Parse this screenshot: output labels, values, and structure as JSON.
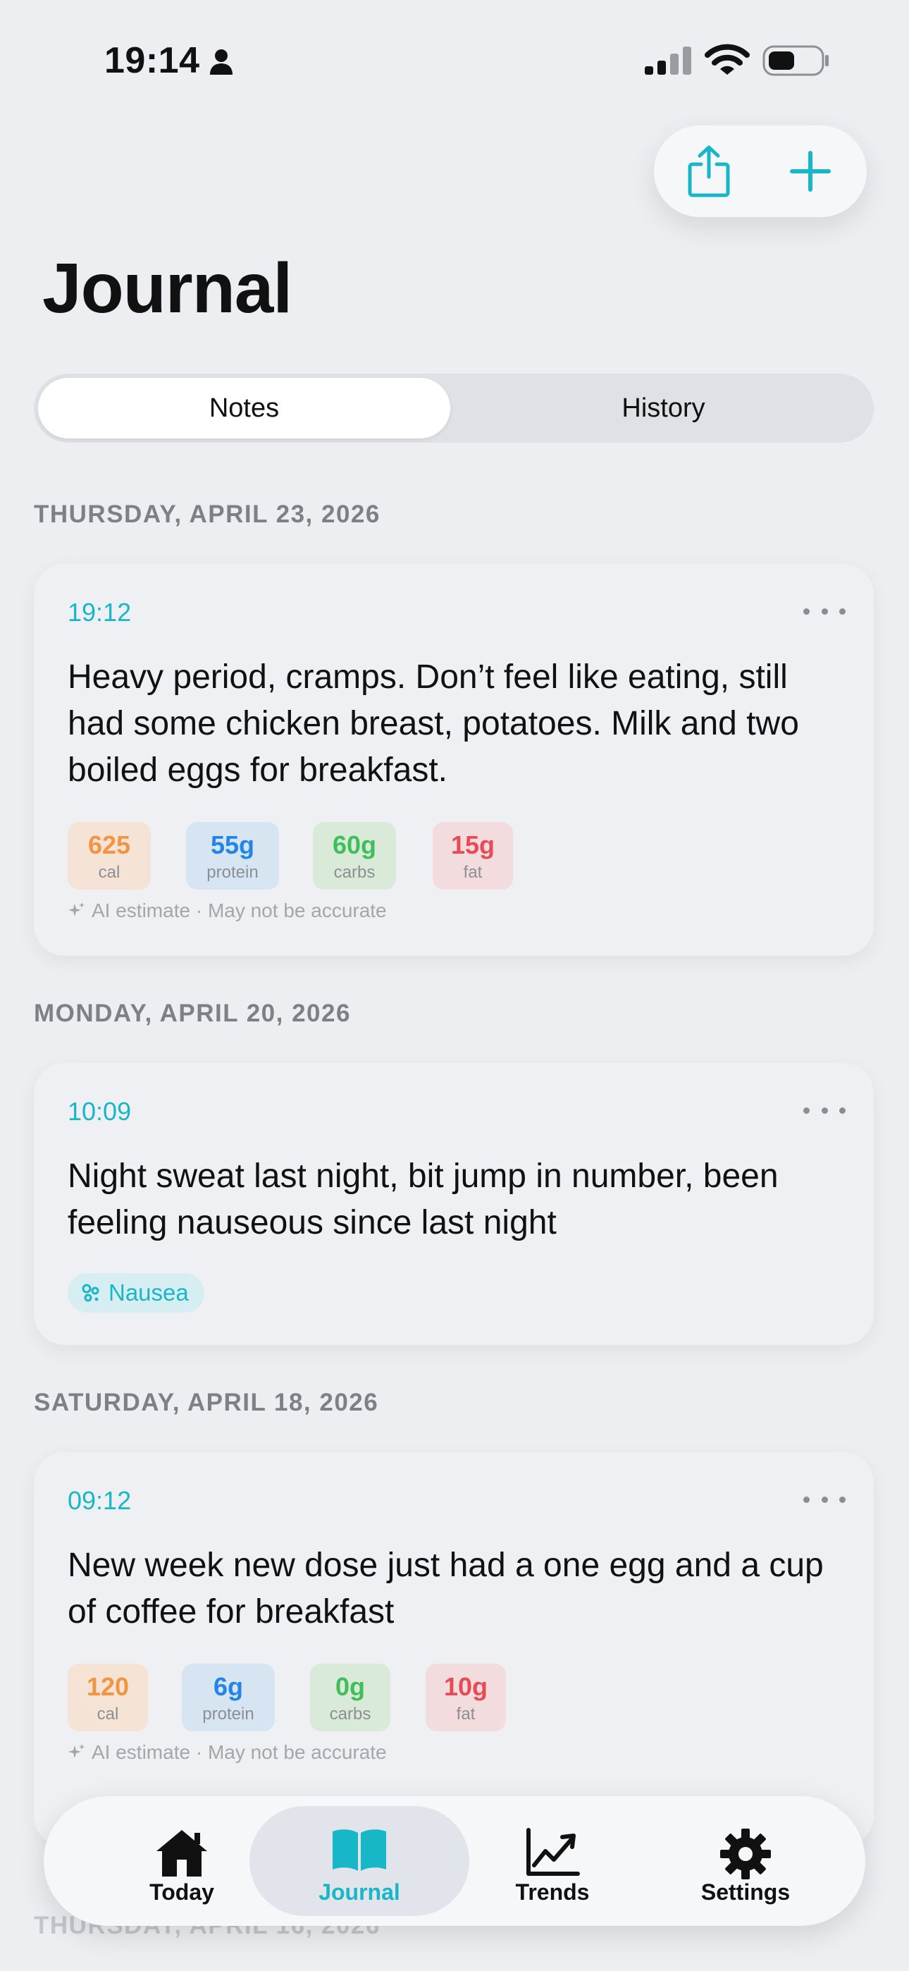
{
  "status_bar": {
    "time": "19:14"
  },
  "header": {
    "title": "Journal"
  },
  "segments": {
    "notes": "Notes",
    "history": "History"
  },
  "entries": [
    {
      "date": "THURSDAY, APRIL 23, 2026",
      "time": "19:12",
      "text": "Heavy period, cramps. Don’t feel like eating, still had some chicken breast, potatoes. Milk and two boiled eggs for breakfast.",
      "macros": {
        "cal": {
          "value": "625",
          "unit": "cal"
        },
        "protein": {
          "value": "55g",
          "unit": "protein"
        },
        "carbs": {
          "value": "60g",
          "unit": "carbs"
        },
        "fat": {
          "value": "15g",
          "unit": "fat"
        }
      },
      "ai_note": "AI estimate · May not be accurate"
    },
    {
      "date": "MONDAY, APRIL 20, 2026",
      "time": "10:09",
      "text": "Night sweat last night, bit jump in number, been feeling nauseous since last night",
      "tag": "Nausea"
    },
    {
      "date": "SATURDAY, APRIL 18, 2026",
      "time": "09:12",
      "text": "New week new dose just had a one egg and a cup of coffee for breakfast",
      "macros": {
        "cal": {
          "value": "120",
          "unit": "cal"
        },
        "protein": {
          "value": "6g",
          "unit": "protein"
        },
        "carbs": {
          "value": "0g",
          "unit": "carbs"
        },
        "fat": {
          "value": "10g",
          "unit": "fat"
        }
      },
      "ai_note": "AI estimate · May not be accurate"
    }
  ],
  "partial_header": "THURSDAY, APRIL 16, 2026",
  "tabbar": {
    "today": "Today",
    "journal": "Journal",
    "trends": "Trends",
    "settings": "Settings"
  },
  "colors": {
    "accent": "#18b7c8",
    "background": "#eceef2"
  },
  "icons": [
    "person-icon",
    "signal-icon",
    "wifi-icon",
    "battery-icon",
    "share-icon",
    "plus-icon",
    "more-icon",
    "sparkle-icon",
    "nausea-icon",
    "home-icon",
    "book-icon",
    "trends-icon",
    "gear-icon"
  ]
}
